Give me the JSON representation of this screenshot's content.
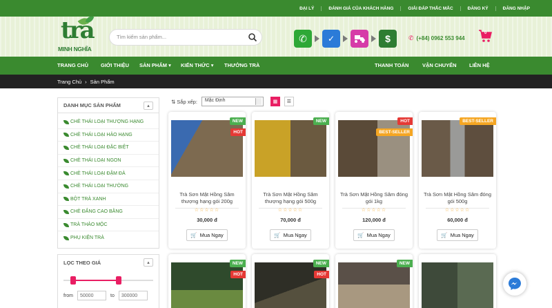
{
  "topbar": {
    "links": [
      "ĐẠI LÝ",
      "ĐÁNH GIÁ CỦA KHÁCH HÀNG",
      "GIẢI ĐÁP THẮC MẮC",
      "ĐĂNG KÝ",
      "ĐĂNG NHẬP"
    ]
  },
  "logo": {
    "big": "trà",
    "brand": "MINH NGHĨA"
  },
  "search": {
    "placeholder": "Tìm kiếm sản phẩm..."
  },
  "contact": {
    "phone": "(+84) 0962 553 944",
    "cart_count": "0"
  },
  "steps": [
    {
      "icon": "phone-icon",
      "color": "#2ea836",
      "glyph": "✆"
    },
    {
      "icon": "clipboard-icon",
      "color": "#2b7bd8",
      "glyph": "✓"
    },
    {
      "icon": "delivery-icon",
      "color": "#d63ca8",
      "glyph": "🛵"
    },
    {
      "icon": "dollar-icon",
      "color": "#2e7d32",
      "glyph": "$"
    }
  ],
  "nav": {
    "items": [
      "TRANG CHỦ",
      "GIỚI THIỆU",
      "SẢN PHẨM ▾",
      "KIẾN THỨC ▾",
      "THƯỞNG TRÀ"
    ],
    "right": [
      "THANH TOÁN",
      "VẬN CHUYỂN",
      "LIÊN HỆ"
    ]
  },
  "breadcrumb": {
    "home": "Trang Chủ",
    "current": "Sản Phẩm"
  },
  "categories": {
    "title": "DANH MỤC SẢN PHẨM",
    "items": [
      "CHÈ THÁI LOẠI THƯỢNG HẠNG",
      "CHÈ THÁI LOẠI HẢO HẠNG",
      "CHÈ THÁI LOẠI ĐẶC BIỆT",
      "CHÈ THÁI LOẠI NGON",
      "CHÈ THÁI LOẠI ĐẬM ĐÀ",
      "CHÈ THÁI LOẠI THƯỜNG",
      "BỘT TRÀ XANH",
      "CHÈ ĐẮNG CAO BẰNG",
      "TRÀ THẢO MỘC",
      "PHỤ KIỆN TRÀ"
    ]
  },
  "filter": {
    "title": "LỌC THEO GIÁ",
    "from_label": "from",
    "from_value": "50000",
    "to_label": "to",
    "to_value": "300000",
    "range_low": 0.17,
    "range_high": 0.58
  },
  "sort": {
    "label": "Sắp xếp:",
    "value": "Mặc Định"
  },
  "products": [
    {
      "name": "Trà Sơn Mật Hồng Sâm thượng hạng gói 200g",
      "price": "30,000 đ",
      "badges": [
        "NEW",
        "HOT"
      ],
      "img": "#7a6a55"
    },
    {
      "name": "Trà Sơn Mật Hồng Sâm thượng hạng gói 500g",
      "price": "70,000 đ",
      "badges": [
        "NEW"
      ],
      "img": "#8b7a3a"
    },
    {
      "name": "Trà Sơn Mật Hồng Sâm đóng gói 1kg",
      "price": "120,000 đ",
      "badges": [
        "HOT",
        "BEST-SELLER"
      ],
      "img": "#6a5a45"
    },
    {
      "name": "Trà Sơn Mật Hồng Sâm đóng gói 500g",
      "price": "60,000 đ",
      "badges": [
        "BEST-SELLER"
      ],
      "img": "#726250"
    }
  ],
  "products2": [
    {
      "badges": [
        "NEW",
        "HOT"
      ],
      "img": "#3d5a3a"
    },
    {
      "badges": [
        "NEW",
        "HOT"
      ],
      "img": "#3a3a30"
    },
    {
      "badges": [
        "NEW"
      ],
      "img": "#8a8580"
    },
    {
      "badges": [],
      "img": "#4a5545"
    }
  ],
  "buy_label": "Mua Ngay",
  "stars": "☆☆☆☆☆",
  "colors": {
    "primary": "#3a8a2f",
    "accent": "#e91e63"
  }
}
